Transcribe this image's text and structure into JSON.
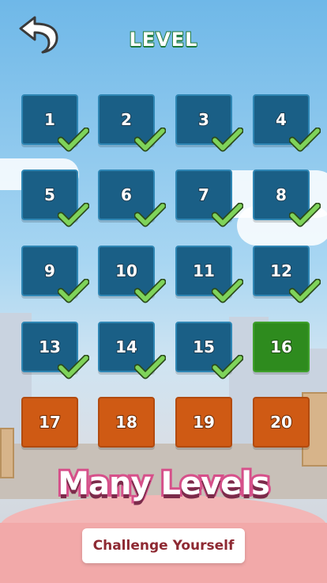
{
  "header": {
    "title": "LEVEL",
    "back_icon": "back-arrow-icon"
  },
  "levels": [
    {
      "label": "1",
      "status": "completed"
    },
    {
      "label": "2",
      "status": "completed"
    },
    {
      "label": "3",
      "status": "completed"
    },
    {
      "label": "4",
      "status": "completed"
    },
    {
      "label": "5",
      "status": "completed"
    },
    {
      "label": "6",
      "status": "completed"
    },
    {
      "label": "7",
      "status": "completed"
    },
    {
      "label": "8",
      "status": "completed"
    },
    {
      "label": "9",
      "status": "completed"
    },
    {
      "label": "10",
      "status": "completed"
    },
    {
      "label": "11",
      "status": "completed"
    },
    {
      "label": "12",
      "status": "completed"
    },
    {
      "label": "13",
      "status": "completed"
    },
    {
      "label": "14",
      "status": "completed"
    },
    {
      "label": "15",
      "status": "completed"
    },
    {
      "label": "16",
      "status": "current"
    },
    {
      "label": "17",
      "status": "locked"
    },
    {
      "label": "18",
      "status": "locked"
    },
    {
      "label": "19",
      "status": "locked"
    },
    {
      "label": "20",
      "status": "locked"
    }
  ],
  "promo": {
    "headline": "Many Levels",
    "button_label": "Challenge Yourself"
  },
  "colors": {
    "completed": "#1a5f86",
    "current": "#2e8b1e",
    "locked": "#cf5a14",
    "check": "#7fd35a",
    "title_stroke": "#1f7a3a",
    "promo_stroke": "#d6508a"
  }
}
